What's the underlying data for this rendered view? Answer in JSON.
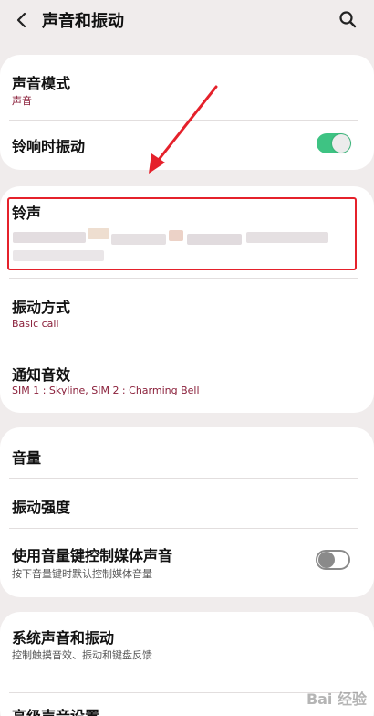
{
  "header": {
    "title": "声音和振动",
    "back_icon": "chevron-left-icon",
    "search_icon": "search-icon"
  },
  "sound_mode": {
    "title": "声音模式",
    "value": "声音"
  },
  "vibrate_on_ring": {
    "title": "铃响时振动",
    "enabled": true
  },
  "ringtone": {
    "title": "铃声"
  },
  "vibration_pattern": {
    "title": "振动方式",
    "value": "Basic call"
  },
  "notification_sound": {
    "title": "通知音效",
    "value": "SIM 1 : Skyline, SIM 2 : Charming Bell"
  },
  "volume": {
    "title": "音量"
  },
  "vibration_intensity": {
    "title": "振动强度"
  },
  "media_volume_keys": {
    "title": "使用音量键控制媒体声音",
    "desc": "按下音量键时默认控制媒体音量",
    "enabled": false
  },
  "system_sound": {
    "title": "系统声音和振动",
    "desc": "控制触摸音效、振动和键盘反馈"
  },
  "advanced_sound": {
    "title": "高级声音设置"
  },
  "colors": {
    "accent": "#3ec383",
    "highlight": "#e5212b",
    "subtitle": "#8a1f3a"
  },
  "watermark": {
    "text": "Bai 经验"
  }
}
